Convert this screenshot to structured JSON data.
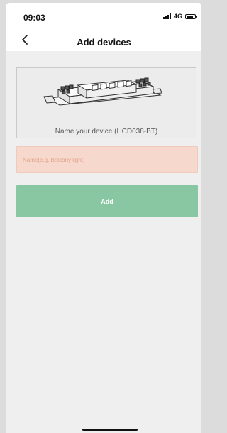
{
  "status_bar": {
    "time": "09:03",
    "network": "4G"
  },
  "header": {
    "back_icon": "chevron-left-icon",
    "title": "Add devices"
  },
  "device_card": {
    "image": "led-driver-device-illustration",
    "caption": "Name your device (HCD038-BT)"
  },
  "name_input": {
    "value": "",
    "placeholder": "Name(e.g. Balcony light)"
  },
  "add_button": {
    "label": "Add",
    "color": "#88c7a2"
  },
  "colors": {
    "input_background": "#f6d9cc",
    "page_background": "#efefef"
  }
}
